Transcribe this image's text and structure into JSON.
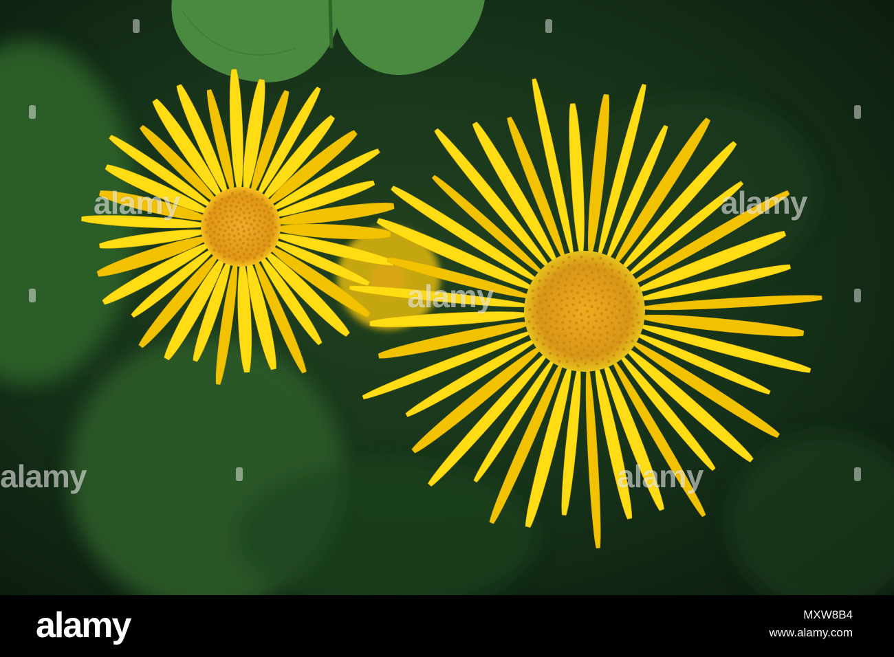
{
  "photo": {
    "subject": "two yellow daisy-like flowers",
    "colors": {
      "background_dark": "#112615",
      "leaf": "#3f7a3a",
      "leaf_light": "#5a9a4c",
      "petal": "#ffdc14",
      "petal_shadow": "#f2c200",
      "center": "#e9a216",
      "center_dark": "#c98412"
    }
  },
  "watermark": {
    "text": "alamy"
  },
  "footer": {
    "logo": "alamy",
    "image_id": "MXW8B4",
    "url": "www.alamy.com"
  }
}
